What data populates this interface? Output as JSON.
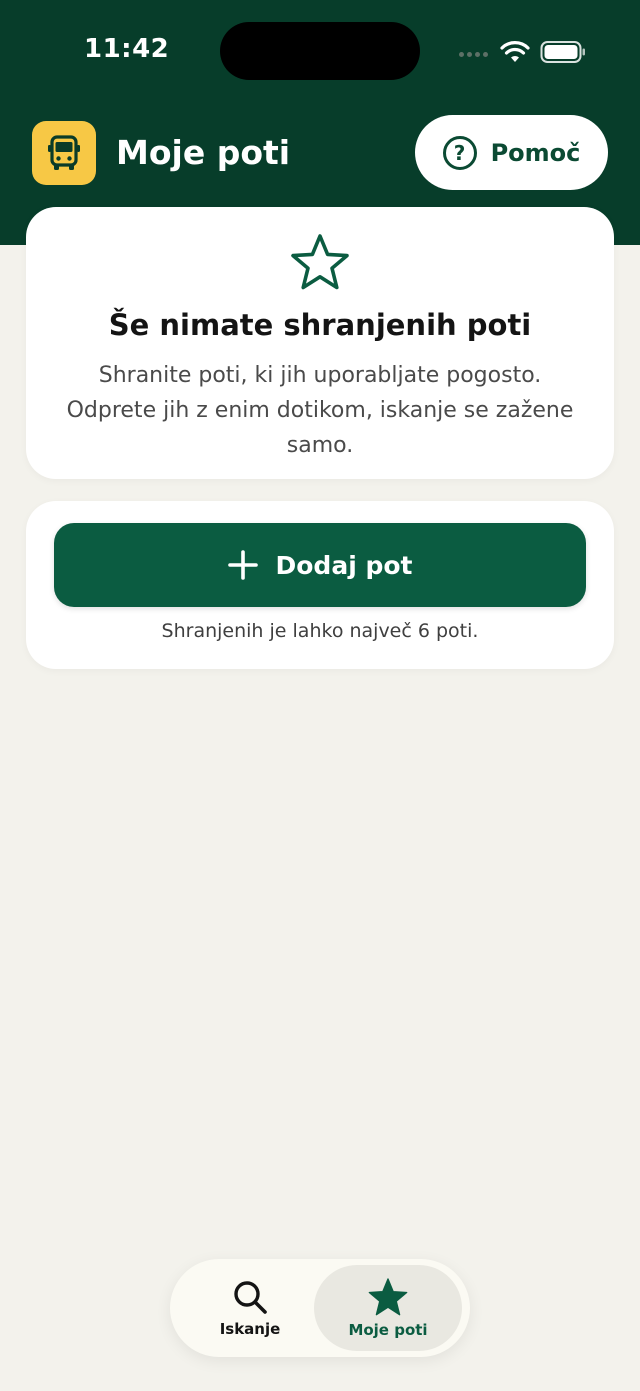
{
  "status_bar": {
    "time": "11:42"
  },
  "header": {
    "title": "Moje poti",
    "help_label": "Pomoč",
    "help_glyph": "?"
  },
  "empty_state": {
    "icon": "star-outline-icon",
    "title": "Še nimate shranjenih poti",
    "description": "Shranite poti, ki jih uporabljate pogosto. Odprete jih z enim dotikom, iskanje se zažene samo."
  },
  "add_section": {
    "button_label": "Dodaj pot",
    "hint": "Shranjenih je lahko največ 6 poti."
  },
  "tab_bar": {
    "tabs": [
      {
        "label": "Iskanje",
        "icon": "search-icon",
        "selected": false
      },
      {
        "label": "Moje poti",
        "icon": "star-icon",
        "selected": true
      }
    ]
  },
  "colors": {
    "header_bg": "#073d2a",
    "accent": "#0b5c41",
    "app_icon_bg": "#f7c845",
    "page_bg": "#f3f2ec"
  }
}
